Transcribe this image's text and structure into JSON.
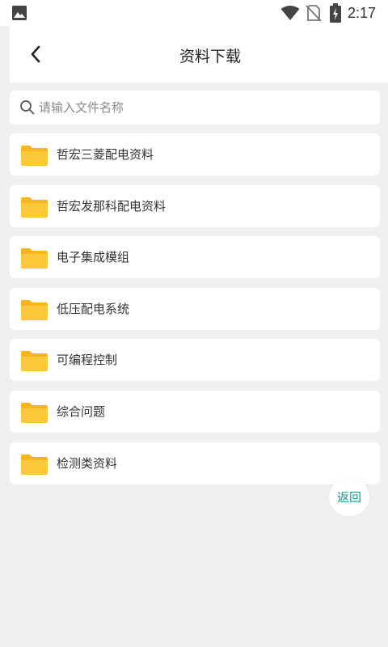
{
  "status_bar": {
    "time": "2:17",
    "icons": [
      "gallery-icon",
      "wifi-icon",
      "no-sim-icon",
      "battery-charging-icon"
    ]
  },
  "header": {
    "title": "资料下载",
    "back_icon": "chevron-left-icon"
  },
  "search": {
    "placeholder": "请输入文件名称",
    "value": "",
    "icon": "search-icon"
  },
  "folders": [
    {
      "label": "哲宏三菱配电资料",
      "icon": "folder-icon"
    },
    {
      "label": "哲宏发那科配电资料",
      "icon": "folder-icon"
    },
    {
      "label": "电子集成模组",
      "icon": "folder-icon"
    },
    {
      "label": "低压配电系统",
      "icon": "folder-icon"
    },
    {
      "label": "可编程控制",
      "icon": "folder-icon"
    },
    {
      "label": "综合问题",
      "icon": "folder-icon"
    },
    {
      "label": "检测类资料",
      "icon": "folder-icon"
    }
  ],
  "return_button": {
    "label": "返回"
  },
  "colors": {
    "background": "#f0f0f0",
    "card": "#ffffff",
    "folder": "#fbc531",
    "accent": "#1a9a8a"
  }
}
